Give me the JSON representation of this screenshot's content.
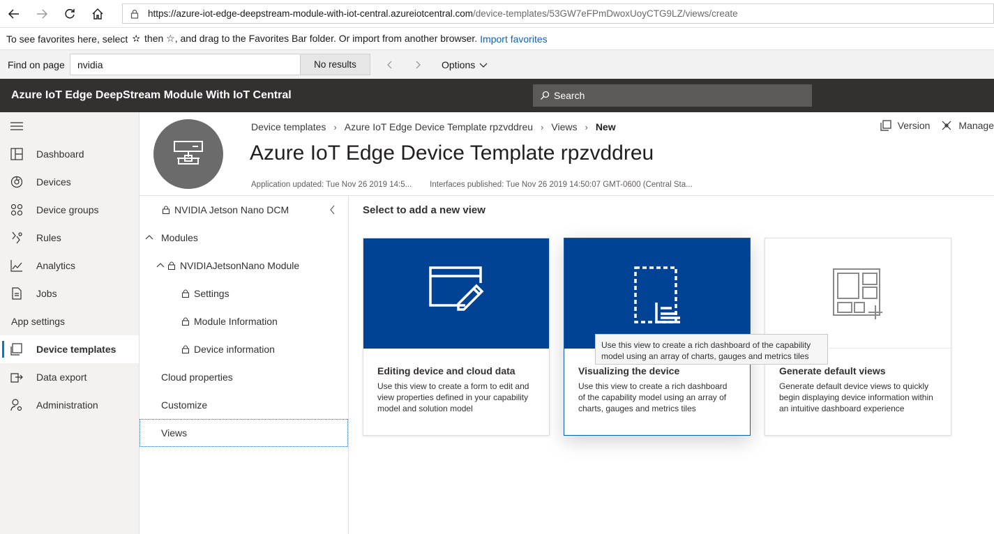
{
  "browser": {
    "url_host": "https://azure-iot-edge-deepstream-module-with-iot-central.azureiotcentral.com",
    "url_path": "/device-templates/53GW7eFPmDwoxUoyCTG9LZ/views/create"
  },
  "favorites_bar": {
    "text_before": "To see favorites here, select",
    "text_after": "then ☆, and drag to the Favorites Bar folder. Or import from another browser.",
    "link": "Import favorites"
  },
  "find_bar": {
    "label": "Find on page",
    "value": "nvidia",
    "results": "No results",
    "options": "Options"
  },
  "app": {
    "title": "Azure IoT Edge DeepStream Module With IoT Central",
    "search_placeholder": "Search"
  },
  "left_nav": {
    "items": [
      {
        "label": "Dashboard",
        "icon": "dashboard-icon"
      },
      {
        "label": "Devices",
        "icon": "devices-icon"
      },
      {
        "label": "Device groups",
        "icon": "device-groups-icon"
      },
      {
        "label": "Rules",
        "icon": "rules-icon"
      },
      {
        "label": "Analytics",
        "icon": "analytics-icon"
      },
      {
        "label": "Jobs",
        "icon": "jobs-icon"
      }
    ],
    "section": "App settings",
    "settings_items": [
      {
        "label": "Device templates",
        "icon": "device-templates-icon"
      },
      {
        "label": "Data export",
        "icon": "data-export-icon"
      },
      {
        "label": "Administration",
        "icon": "administration-icon"
      }
    ]
  },
  "breadcrumb": [
    "Device templates",
    "Azure IoT Edge Device Template rpzvddreu",
    "Views",
    "New"
  ],
  "top_actions": {
    "version": "Version",
    "manage": "Manage"
  },
  "page": {
    "title": "Azure IoT Edge Device Template rpzvddreu",
    "app_updated": "Application updated: Tue Nov 26 2019 14:5...",
    "interfaces_published": "Interfaces published: Tue Nov 26 2019 14:50:07 GMT-0600 (Central Sta..."
  },
  "tree": {
    "root": "NVIDIA Jetson Nano DCM",
    "modules": "Modules",
    "module": "NVIDIAJetsonNano Module",
    "module_children": [
      "Settings",
      "Module Information",
      "Device information"
    ],
    "cloud_properties": "Cloud properties",
    "customize": "Customize",
    "views": "Views"
  },
  "content": {
    "heading": "Select to add a new view",
    "cards": [
      {
        "title": "Editing device and cloud data",
        "description": "Use this view to create a form to edit and view properties defined in your capability model and solution model"
      },
      {
        "title": "Visualizing the device",
        "description": "Use this view to create a rich dashboard of the capability model using an array of charts, gauges and metrics tiles"
      },
      {
        "title": "Generate default views",
        "description": "Generate default device views to quickly begin displaying device information within an intuitive dashboard experience"
      }
    ],
    "tooltip": "Use this view to create a rich dashboard of the capability model using an array of charts, gauges and metrics tiles"
  },
  "colors": {
    "header": "#323130",
    "card_blue": "#004394",
    "accent": "#0078d4",
    "link": "#0b62c4"
  }
}
